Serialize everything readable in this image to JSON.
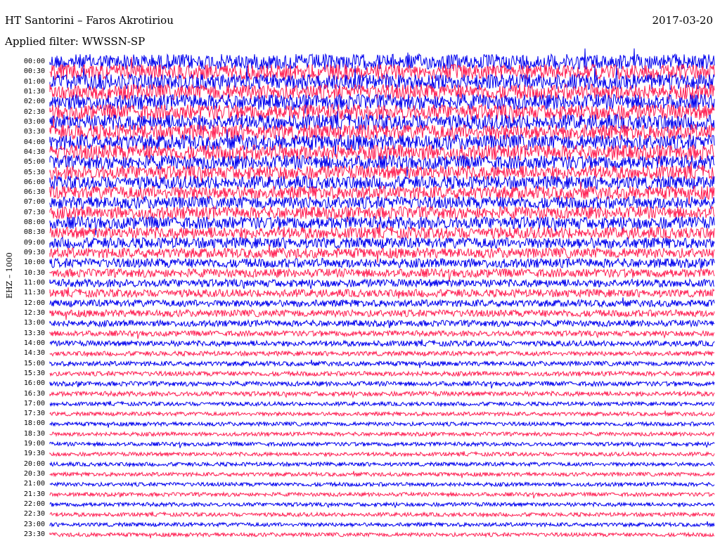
{
  "header": {
    "station": "HT Santorini – Faros Akrotiriou",
    "date": "2017-03-20",
    "filter": "Applied filter: WWSSN-SP"
  },
  "channel_label": "EHZ – 1000",
  "colors": {
    "trace_a": "#0000ee",
    "trace_b": "#ff2255",
    "background": "#ffffff"
  },
  "chart_data": {
    "type": "line",
    "title": "HT Santorini – Faros Akrotiriou",
    "subtitle": "Applied filter: WWSSN-SP",
    "ylabel": "EHZ – 1000",
    "grid": false,
    "rows": [
      "00:00",
      "00:30",
      "01:00",
      "01:30",
      "02:00",
      "02:30",
      "03:00",
      "03:30",
      "04:00",
      "04:30",
      "05:00",
      "05:30",
      "06:00",
      "06:30",
      "07:00",
      "07:30",
      "08:00",
      "08:30",
      "09:00",
      "09:30",
      "10:00",
      "10:30",
      "11:00",
      "11:30",
      "12:00",
      "12:30",
      "13:00",
      "13:30",
      "14:00",
      "14:30",
      "15:00",
      "15:30",
      "16:00",
      "16:30",
      "17:00",
      "17:30",
      "18:00",
      "18:30",
      "19:00",
      "19:30",
      "20:00",
      "20:30",
      "21:00",
      "21:30",
      "22:00",
      "22:30",
      "23:00",
      "23:30"
    ],
    "row_colors": [
      "blue",
      "red"
    ],
    "relative_noise_amplitude": [
      1.0,
      1.0,
      1.0,
      1.0,
      1.0,
      1.0,
      1.0,
      1.0,
      1.0,
      1.0,
      0.9,
      0.9,
      0.85,
      0.85,
      0.8,
      0.8,
      0.8,
      0.75,
      0.7,
      0.65,
      0.6,
      0.55,
      0.5,
      0.5,
      0.45,
      0.45,
      0.4,
      0.35,
      0.35,
      0.3,
      0.3,
      0.3,
      0.3,
      0.3,
      0.25,
      0.25,
      0.25,
      0.25,
      0.25,
      0.25,
      0.25,
      0.25,
      0.25,
      0.25,
      0.25,
      0.25,
      0.25,
      0.25
    ]
  }
}
